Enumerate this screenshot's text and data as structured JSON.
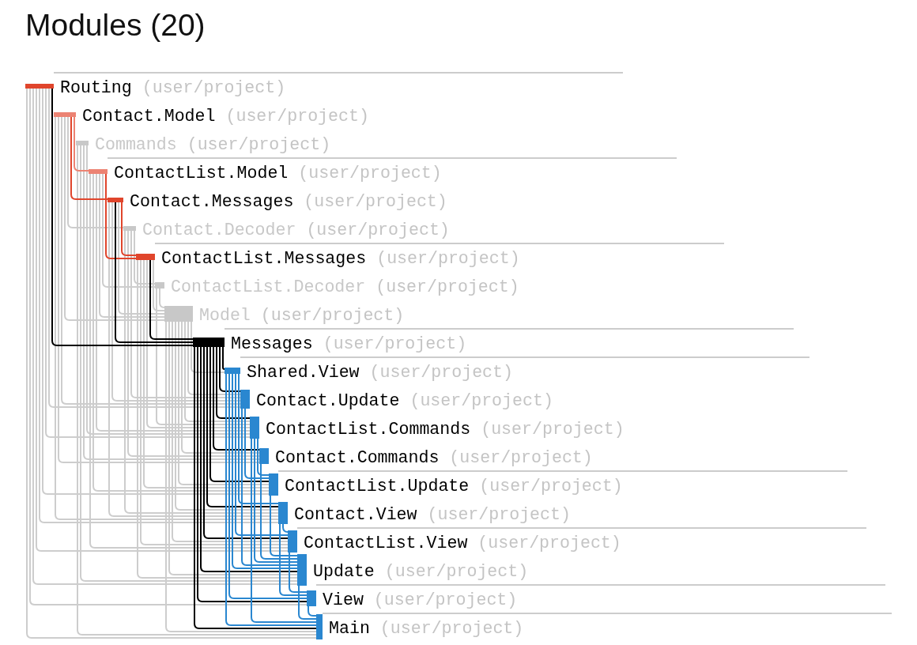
{
  "title": "Modules (20)",
  "layers": [
    {
      "modules": [
        {
          "name": "Routing",
          "package": "(user/project)",
          "kind": "direct-dependency",
          "selected": false
        },
        {
          "name": "Contact.Model",
          "package": "(user/project)",
          "kind": "indirect-dependency",
          "selected": false
        },
        {
          "name": "Commands",
          "package": "(user/project)",
          "kind": "unrelated",
          "selected": false
        }
      ]
    },
    {
      "modules": [
        {
          "name": "ContactList.Model",
          "package": "(user/project)",
          "kind": "indirect-dependency",
          "selected": false
        },
        {
          "name": "Contact.Messages",
          "package": "(user/project)",
          "kind": "direct-dependency",
          "selected": false
        },
        {
          "name": "Contact.Decoder",
          "package": "(user/project)",
          "kind": "unrelated",
          "selected": false
        }
      ]
    },
    {
      "modules": [
        {
          "name": "ContactList.Messages",
          "package": "(user/project)",
          "kind": "direct-dependency",
          "selected": false
        },
        {
          "name": "ContactList.Decoder",
          "package": "(user/project)",
          "kind": "unrelated",
          "selected": false
        },
        {
          "name": "Model",
          "package": "(user/project)",
          "kind": "unrelated",
          "selected": false
        }
      ]
    },
    {
      "modules": [
        {
          "name": "Messages",
          "package": "(user/project)",
          "kind": "self",
          "selected": true
        }
      ]
    },
    {
      "modules": [
        {
          "name": "Shared.View",
          "package": "(user/project)",
          "kind": "dependent",
          "selected": false
        },
        {
          "name": "Contact.Update",
          "package": "(user/project)",
          "kind": "dependent",
          "selected": false
        },
        {
          "name": "ContactList.Commands",
          "package": "(user/project)",
          "kind": "dependent",
          "selected": false
        },
        {
          "name": "Contact.Commands",
          "package": "(user/project)",
          "kind": "dependent",
          "selected": false
        }
      ]
    },
    {
      "modules": [
        {
          "name": "ContactList.Update",
          "package": "(user/project)",
          "kind": "dependent",
          "selected": false
        },
        {
          "name": "Contact.View",
          "package": "(user/project)",
          "kind": "dependent",
          "selected": false
        }
      ]
    },
    {
      "modules": [
        {
          "name": "ContactList.View",
          "package": "(user/project)",
          "kind": "dependent",
          "selected": false
        },
        {
          "name": "Update",
          "package": "(user/project)",
          "kind": "dependent",
          "selected": false
        }
      ]
    },
    {
      "modules": [
        {
          "name": "View",
          "package": "(user/project)",
          "kind": "dependent",
          "selected": false
        }
      ]
    },
    {
      "modules": [
        {
          "name": "Main",
          "package": "(user/project)",
          "kind": "dependent",
          "selected": false
        }
      ]
    }
  ]
}
